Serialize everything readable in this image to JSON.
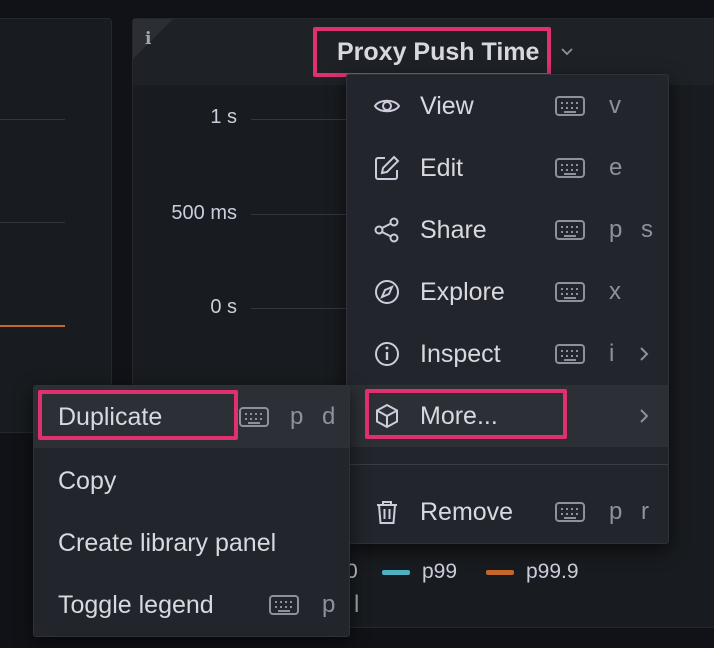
{
  "panel": {
    "title": "Proxy Push Time",
    "info_label": "i",
    "y_ticks": [
      "1 s",
      "500 ms",
      "0 s"
    ]
  },
  "legend": [
    {
      "label": "0",
      "color": ""
    },
    {
      "label": "p99",
      "color": "#4eb0c0"
    },
    {
      "label": "p99.9",
      "color": "#c4672a"
    }
  ],
  "menu": {
    "items": [
      {
        "label": "View",
        "shortcut": "v",
        "icon": "eye-icon"
      },
      {
        "label": "Edit",
        "shortcut": "e",
        "icon": "edit-icon"
      },
      {
        "label": "Share",
        "shortcut": "p s",
        "icon": "share-icon"
      },
      {
        "label": "Explore",
        "shortcut": "x",
        "icon": "compass-icon"
      },
      {
        "label": "Inspect",
        "shortcut": "i",
        "icon": "info-circle-icon"
      },
      {
        "label": "More...",
        "shortcut": "",
        "icon": "cube-icon"
      },
      {
        "label": "Remove",
        "shortcut": "p r",
        "icon": "trash-icon"
      }
    ]
  },
  "submenu": {
    "items": [
      {
        "label": "Duplicate",
        "shortcut": "p d"
      },
      {
        "label": "Copy",
        "shortcut": ""
      },
      {
        "label": "Create library panel",
        "shortcut": ""
      },
      {
        "label": "Toggle legend",
        "shortcut": "p l"
      }
    ]
  },
  "colors": {
    "highlight": "#e0306f",
    "orange_series": "#c4672a",
    "teal_series": "#4eb0c0"
  }
}
